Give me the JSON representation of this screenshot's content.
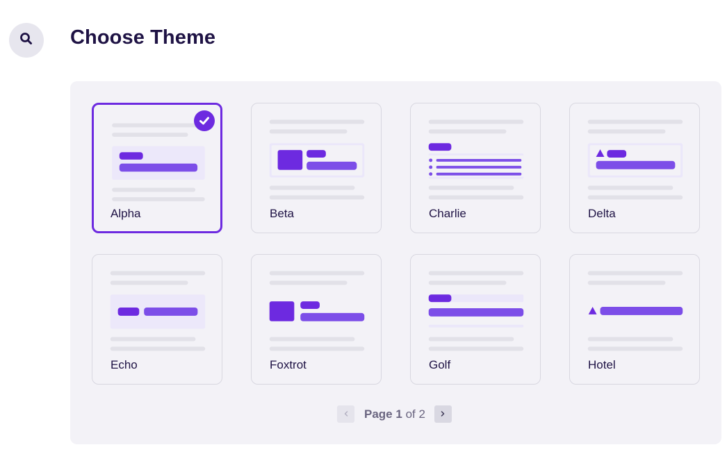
{
  "header": {
    "title": "Choose Theme",
    "search_icon": "search-icon"
  },
  "colors": {
    "accent": "#6d2ae0",
    "accent_light": "#7c4ee8",
    "panel_bg": "#f3f2f7",
    "title": "#1e1244"
  },
  "themes": [
    {
      "name": "Alpha",
      "selected": true
    },
    {
      "name": "Beta",
      "selected": false
    },
    {
      "name": "Charlie",
      "selected": false
    },
    {
      "name": "Delta",
      "selected": false
    },
    {
      "name": "Echo",
      "selected": false
    },
    {
      "name": "Foxtrot",
      "selected": false
    },
    {
      "name": "Golf",
      "selected": false
    },
    {
      "name": "Hotel",
      "selected": false
    }
  ],
  "pagination": {
    "page_word": "Page",
    "current": "1",
    "of_word": "of",
    "total": "2",
    "prev_icon": "chevron-left-icon",
    "next_icon": "chevron-right-icon"
  }
}
